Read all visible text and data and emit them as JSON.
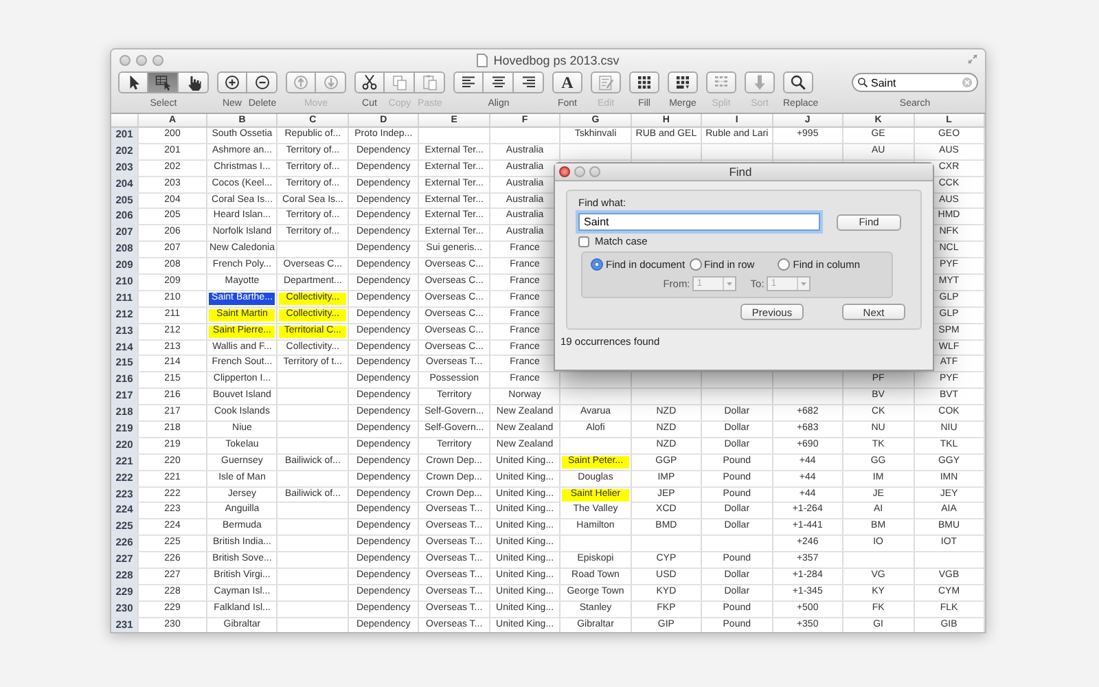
{
  "window": {
    "title": "Hovedbog ps 2013.csv"
  },
  "toolbar": [
    {
      "label": "Select",
      "buttons": [
        {
          "kind": "pointer",
          "selected": false,
          "disabled": false
        },
        {
          "kind": "grid-pointer",
          "selected": true,
          "disabled": false
        },
        {
          "kind": "hand",
          "selected": false,
          "disabled": false
        }
      ]
    },
    {
      "buttons": [
        {
          "kind": "plus",
          "label": "New",
          "disabled": false
        },
        {
          "kind": "minus",
          "label": "Delete",
          "disabled": false
        }
      ]
    },
    {
      "label": "Move",
      "buttons": [
        {
          "kind": "arrow-up",
          "disabled": true
        },
        {
          "kind": "arrow-down",
          "disabled": true
        }
      ]
    },
    {
      "buttons": [
        {
          "kind": "scissors",
          "label": "Cut",
          "disabled": false
        },
        {
          "kind": "copy",
          "label": "Copy",
          "disabled": true
        },
        {
          "kind": "paste",
          "label": "Paste",
          "disabled": true
        }
      ]
    },
    {
      "label": "Align",
      "buttons": [
        {
          "kind": "align-left",
          "disabled": false
        },
        {
          "kind": "align-center",
          "disabled": false
        },
        {
          "kind": "align-right",
          "disabled": false
        }
      ]
    },
    {
      "buttons": [
        {
          "kind": "font",
          "glyph": "A",
          "label": "Font",
          "disabled": false
        }
      ]
    },
    {
      "buttons": [
        {
          "kind": "notepad",
          "label": "Edit",
          "disabled": true
        }
      ]
    },
    {
      "buttons": [
        {
          "kind": "grid",
          "label": "Fill",
          "disabled": false
        }
      ]
    },
    {
      "buttons": [
        {
          "kind": "grid-merge",
          "label": "Merge",
          "disabled": false
        }
      ]
    },
    {
      "buttons": [
        {
          "kind": "grid-split",
          "label": "Split",
          "disabled": true
        }
      ]
    },
    {
      "buttons": [
        {
          "kind": "sort-arrow",
          "label": "Sort",
          "disabled": true
        }
      ]
    },
    {
      "buttons": [
        {
          "kind": "search",
          "label": "Replace",
          "disabled": false
        }
      ]
    }
  ],
  "search": {
    "value": "Saint",
    "label": "Search"
  },
  "table": {
    "columns": [
      "A",
      "B",
      "C",
      "D",
      "E",
      "F",
      "G",
      "H",
      "I",
      "J",
      "K",
      "L"
    ],
    "rows": [
      {
        "number": "201",
        "cells": [
          "200",
          "South Ossetia",
          "Republic of...",
          "Proto Indep...",
          null,
          null,
          "Tskhinvali",
          "RUB and GEL",
          "Ruble and Lari",
          "+995",
          "GE",
          "GEO"
        ]
      },
      {
        "number": "202",
        "cells": [
          "201",
          "Ashmore an...",
          "Territory of...",
          "Dependency",
          "External Ter...",
          "Australia",
          null,
          null,
          null,
          null,
          "AU",
          "AUS"
        ]
      },
      {
        "number": "203",
        "cells": [
          "202",
          "Christmas I...",
          "Territory of...",
          "Dependency",
          "External Ter...",
          "Australia",
          null,
          null,
          null,
          null,
          null,
          "CXR"
        ]
      },
      {
        "number": "204",
        "cells": [
          "203",
          "Cocos (Keel...",
          "Territory of...",
          "Dependency",
          "External Ter...",
          "Australia",
          null,
          null,
          null,
          null,
          null,
          "CCK"
        ]
      },
      {
        "number": "205",
        "cells": [
          "204",
          "Coral Sea Is...",
          "Coral Sea Is...",
          "Dependency",
          "External Ter...",
          "Australia",
          null,
          null,
          null,
          null,
          null,
          "AUS"
        ]
      },
      {
        "number": "206",
        "cells": [
          "205",
          "Heard Islan...",
          "Territory of...",
          "Dependency",
          "External Ter...",
          "Australia",
          null,
          null,
          null,
          null,
          null,
          "HMD"
        ]
      },
      {
        "number": "207",
        "cells": [
          "206",
          "Norfolk Island",
          "Territory of...",
          "Dependency",
          "External Ter...",
          "Australia",
          null,
          null,
          null,
          null,
          null,
          "NFK"
        ]
      },
      {
        "number": "208",
        "cells": [
          "207",
          "New Caledonia",
          null,
          "Dependency",
          "Sui generis...",
          "France",
          null,
          null,
          null,
          null,
          null,
          "NCL"
        ]
      },
      {
        "number": "209",
        "cells": [
          "208",
          "French Poly...",
          "Overseas C...",
          "Dependency",
          "Overseas C...",
          "France",
          null,
          null,
          null,
          null,
          null,
          "PYF"
        ]
      },
      {
        "number": "210",
        "cells": [
          "209",
          "Mayotte",
          "Department...",
          "Dependency",
          "Overseas C...",
          "France",
          null,
          null,
          null,
          null,
          null,
          "MYT"
        ]
      },
      {
        "number": "211",
        "cells": [
          "210",
          {
            "text": "Saint Barthe...",
            "found": true,
            "selected": true
          },
          {
            "text": "Collectivity...",
            "found": true,
            "selected": false
          },
          "Dependency",
          "Overseas C...",
          "France",
          null,
          null,
          null,
          null,
          null,
          "GLP"
        ]
      },
      {
        "number": "212",
        "cells": [
          "211",
          {
            "text": "Saint Martin",
            "found": true,
            "selected": false
          },
          {
            "text": "Collectivity...",
            "found": true,
            "selected": false
          },
          "Dependency",
          "Overseas C...",
          "France",
          null,
          null,
          null,
          null,
          null,
          "GLP"
        ]
      },
      {
        "number": "213",
        "cells": [
          "212",
          {
            "text": "Saint Pierre...",
            "found": true,
            "selected": false
          },
          {
            "text": "Territorial C...",
            "found": true,
            "selected": false
          },
          "Dependency",
          "Overseas C...",
          "France",
          null,
          null,
          null,
          null,
          null,
          "SPM"
        ]
      },
      {
        "number": "214",
        "cells": [
          "213",
          "Wallis and F...",
          "Collectivity...",
          "Dependency",
          "Overseas C...",
          "France",
          null,
          null,
          null,
          null,
          null,
          "WLF"
        ]
      },
      {
        "number": "215",
        "cells": [
          "214",
          "French Sout...",
          "Territory of t...",
          "Dependency",
          "Overseas T...",
          "France",
          null,
          null,
          null,
          null,
          null,
          "ATF"
        ]
      },
      {
        "number": "216",
        "cells": [
          "215",
          "Clipperton I...",
          null,
          "Dependency",
          "Possession",
          "France",
          null,
          null,
          null,
          null,
          "PF",
          "PYF"
        ]
      },
      {
        "number": "217",
        "cells": [
          "216",
          "Bouvet Island",
          null,
          "Dependency",
          "Territory",
          "Norway",
          null,
          null,
          null,
          null,
          "BV",
          "BVT"
        ]
      },
      {
        "number": "218",
        "cells": [
          "217",
          "Cook Islands",
          null,
          "Dependency",
          "Self-Govern...",
          "New Zealand",
          "Avarua",
          "NZD",
          "Dollar",
          "+682",
          "CK",
          "COK"
        ]
      },
      {
        "number": "219",
        "cells": [
          "218",
          "Niue",
          null,
          "Dependency",
          "Self-Govern...",
          "New Zealand",
          "Alofi",
          "NZD",
          "Dollar",
          "+683",
          "NU",
          "NIU"
        ]
      },
      {
        "number": "220",
        "cells": [
          "219",
          "Tokelau",
          null,
          "Dependency",
          "Territory",
          "New Zealand",
          null,
          "NZD",
          "Dollar",
          "+690",
          "TK",
          "TKL"
        ]
      },
      {
        "number": "221",
        "cells": [
          "220",
          "Guernsey",
          "Bailiwick of...",
          "Dependency",
          "Crown Dep...",
          "United King...",
          {
            "text": "Saint Peter...",
            "found": true,
            "selected": false
          },
          "GGP",
          "Pound",
          "+44",
          "GG",
          "GGY"
        ]
      },
      {
        "number": "222",
        "cells": [
          "221",
          "Isle of Man",
          null,
          "Dependency",
          "Crown Dep...",
          "United King...",
          "Douglas",
          "IMP",
          "Pound",
          "+44",
          "IM",
          "IMN"
        ]
      },
      {
        "number": "223",
        "cells": [
          "222",
          "Jersey",
          "Bailiwick of...",
          "Dependency",
          "Crown Dep...",
          "United King...",
          {
            "text": "Saint Helier",
            "found": true,
            "selected": false
          },
          "JEP",
          "Pound",
          "+44",
          "JE",
          "JEY"
        ]
      },
      {
        "number": "224",
        "cells": [
          "223",
          "Anguilla",
          null,
          "Dependency",
          "Overseas T...",
          "United King...",
          "The Valley",
          "XCD",
          "Dollar",
          "+1-264",
          "AI",
          "AIA"
        ]
      },
      {
        "number": "225",
        "cells": [
          "224",
          "Bermuda",
          null,
          "Dependency",
          "Overseas T...",
          "United King...",
          "Hamilton",
          "BMD",
          "Dollar",
          "+1-441",
          "BM",
          "BMU"
        ]
      },
      {
        "number": "226",
        "cells": [
          "225",
          "British India...",
          null,
          "Dependency",
          "Overseas T...",
          "United King...",
          null,
          null,
          null,
          "+246",
          "IO",
          "IOT"
        ]
      },
      {
        "number": "227",
        "cells": [
          "226",
          "British Sove...",
          null,
          "Dependency",
          "Overseas T...",
          "United King...",
          "Episkopi",
          "CYP",
          "Pound",
          "+357",
          null,
          null
        ]
      },
      {
        "number": "228",
        "cells": [
          "227",
          "British Virgi...",
          null,
          "Dependency",
          "Overseas T...",
          "United King...",
          "Road Town",
          "USD",
          "Dollar",
          "+1-284",
          "VG",
          "VGB"
        ]
      },
      {
        "number": "229",
        "cells": [
          "228",
          "Cayman Isl...",
          null,
          "Dependency",
          "Overseas T...",
          "United King...",
          "George Town",
          "KYD",
          "Dollar",
          "+1-345",
          "KY",
          "CYM"
        ]
      },
      {
        "number": "230",
        "cells": [
          "229",
          "Falkland Isl...",
          null,
          "Dependency",
          "Overseas T...",
          "United King...",
          "Stanley",
          "FKP",
          "Pound",
          "+500",
          "FK",
          "FLK"
        ]
      },
      {
        "number": "231",
        "cells": [
          "230",
          "Gibraltar",
          null,
          "Dependency",
          "Overseas T...",
          "United King...",
          "Gibraltar",
          "GIP",
          "Pound",
          "+350",
          "GI",
          "GIB"
        ]
      }
    ]
  },
  "find_dialog": {
    "title": "Find",
    "find_label": "Find what:",
    "query": "Saint",
    "find_button": "Find",
    "match_case": {
      "label": "Match case",
      "checked": false
    },
    "scope": [
      {
        "label": "Find in document",
        "selected": true
      },
      {
        "label": "Find in row",
        "selected": false
      },
      {
        "label": "Find in column",
        "selected": false
      }
    ],
    "from": {
      "label": "From:",
      "value": "1",
      "disabled": true
    },
    "to": {
      "label": "To:",
      "value": "1",
      "disabled": true
    },
    "buttons": [
      "Previous",
      "Next"
    ],
    "status": "19 occurrences found"
  }
}
